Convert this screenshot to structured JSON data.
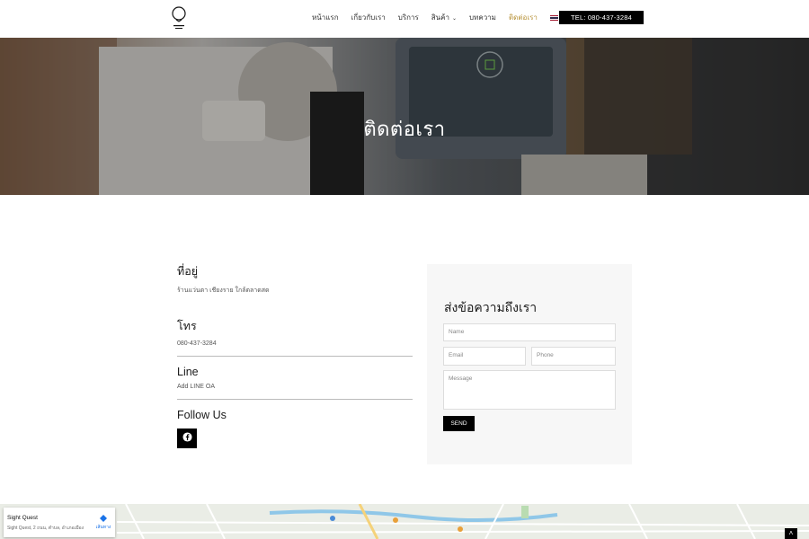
{
  "nav": {
    "items": [
      {
        "label": "หน้าแรก",
        "active": false,
        "caret": false
      },
      {
        "label": "เกี่ยวกับเรา",
        "active": false,
        "caret": false
      },
      {
        "label": "บริการ",
        "active": false,
        "caret": false
      },
      {
        "label": "สินค้า",
        "active": false,
        "caret": true
      },
      {
        "label": "บทความ",
        "active": false,
        "caret": false
      },
      {
        "label": "ติดต่อเรา",
        "active": true,
        "caret": false
      }
    ],
    "language": "TH",
    "tel_button": "TEL: 080-437-3284",
    "active_color": "#b8933a"
  },
  "hero": {
    "title": "ติดต่อเรา"
  },
  "contact": {
    "address_title": "ที่อยู่",
    "address_value": "ร้านแว่นตา เชียงราย ใกล้ตลาดสด",
    "phone_title": "โทร",
    "phone_value": "080-437-3284",
    "line_title": "Line",
    "line_value": "Add LINE OA",
    "follow_title": "Follow Us"
  },
  "form": {
    "title": "ส่งข้อความถึงเรา",
    "name_placeholder": "Name",
    "email_placeholder": "Email",
    "phone_placeholder": "Phone",
    "message_placeholder": "Message",
    "send_label": "SEND"
  },
  "map": {
    "place_name": "Sight Quest",
    "address": "Sight Quest, 2 ถนน, ตำบล, อำเภอเมือง",
    "directions_label": "เส้นทาง"
  },
  "icons": {
    "facebook": "facebook-icon",
    "scroll_top": "chevron-up-icon"
  }
}
